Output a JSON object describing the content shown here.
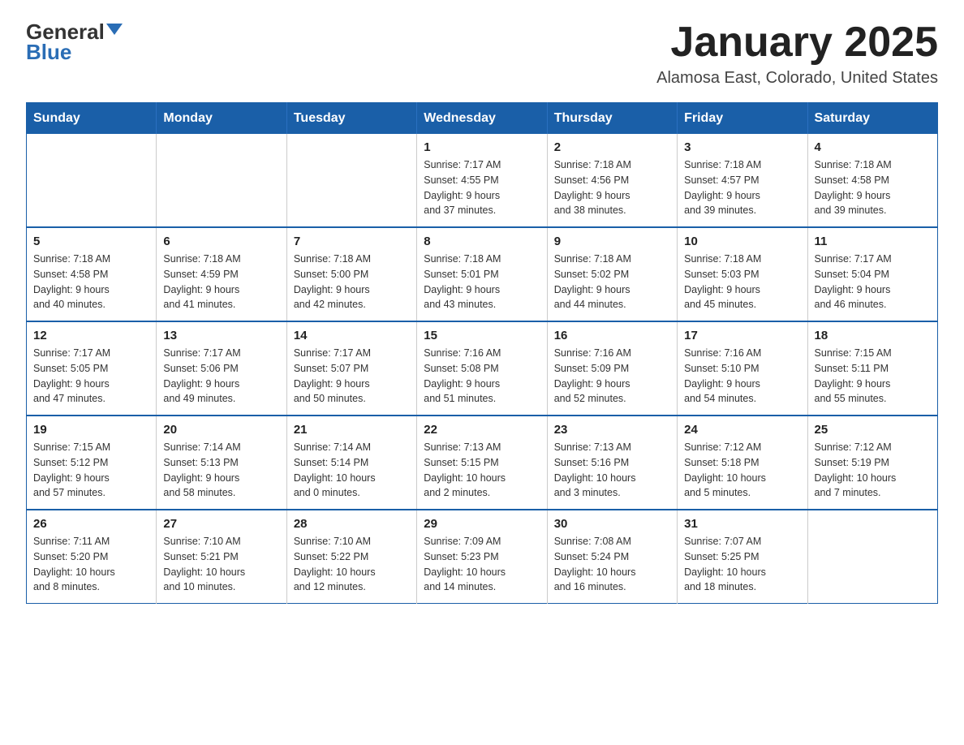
{
  "logo": {
    "general": "General",
    "blue": "Blue"
  },
  "title": "January 2025",
  "location": "Alamosa East, Colorado, United States",
  "days_of_week": [
    "Sunday",
    "Monday",
    "Tuesday",
    "Wednesday",
    "Thursday",
    "Friday",
    "Saturday"
  ],
  "weeks": [
    [
      {
        "day": "",
        "info": ""
      },
      {
        "day": "",
        "info": ""
      },
      {
        "day": "",
        "info": ""
      },
      {
        "day": "1",
        "info": "Sunrise: 7:17 AM\nSunset: 4:55 PM\nDaylight: 9 hours\nand 37 minutes."
      },
      {
        "day": "2",
        "info": "Sunrise: 7:18 AM\nSunset: 4:56 PM\nDaylight: 9 hours\nand 38 minutes."
      },
      {
        "day": "3",
        "info": "Sunrise: 7:18 AM\nSunset: 4:57 PM\nDaylight: 9 hours\nand 39 minutes."
      },
      {
        "day": "4",
        "info": "Sunrise: 7:18 AM\nSunset: 4:58 PM\nDaylight: 9 hours\nand 39 minutes."
      }
    ],
    [
      {
        "day": "5",
        "info": "Sunrise: 7:18 AM\nSunset: 4:58 PM\nDaylight: 9 hours\nand 40 minutes."
      },
      {
        "day": "6",
        "info": "Sunrise: 7:18 AM\nSunset: 4:59 PM\nDaylight: 9 hours\nand 41 minutes."
      },
      {
        "day": "7",
        "info": "Sunrise: 7:18 AM\nSunset: 5:00 PM\nDaylight: 9 hours\nand 42 minutes."
      },
      {
        "day": "8",
        "info": "Sunrise: 7:18 AM\nSunset: 5:01 PM\nDaylight: 9 hours\nand 43 minutes."
      },
      {
        "day": "9",
        "info": "Sunrise: 7:18 AM\nSunset: 5:02 PM\nDaylight: 9 hours\nand 44 minutes."
      },
      {
        "day": "10",
        "info": "Sunrise: 7:18 AM\nSunset: 5:03 PM\nDaylight: 9 hours\nand 45 minutes."
      },
      {
        "day": "11",
        "info": "Sunrise: 7:17 AM\nSunset: 5:04 PM\nDaylight: 9 hours\nand 46 minutes."
      }
    ],
    [
      {
        "day": "12",
        "info": "Sunrise: 7:17 AM\nSunset: 5:05 PM\nDaylight: 9 hours\nand 47 minutes."
      },
      {
        "day": "13",
        "info": "Sunrise: 7:17 AM\nSunset: 5:06 PM\nDaylight: 9 hours\nand 49 minutes."
      },
      {
        "day": "14",
        "info": "Sunrise: 7:17 AM\nSunset: 5:07 PM\nDaylight: 9 hours\nand 50 minutes."
      },
      {
        "day": "15",
        "info": "Sunrise: 7:16 AM\nSunset: 5:08 PM\nDaylight: 9 hours\nand 51 minutes."
      },
      {
        "day": "16",
        "info": "Sunrise: 7:16 AM\nSunset: 5:09 PM\nDaylight: 9 hours\nand 52 minutes."
      },
      {
        "day": "17",
        "info": "Sunrise: 7:16 AM\nSunset: 5:10 PM\nDaylight: 9 hours\nand 54 minutes."
      },
      {
        "day": "18",
        "info": "Sunrise: 7:15 AM\nSunset: 5:11 PM\nDaylight: 9 hours\nand 55 minutes."
      }
    ],
    [
      {
        "day": "19",
        "info": "Sunrise: 7:15 AM\nSunset: 5:12 PM\nDaylight: 9 hours\nand 57 minutes."
      },
      {
        "day": "20",
        "info": "Sunrise: 7:14 AM\nSunset: 5:13 PM\nDaylight: 9 hours\nand 58 minutes."
      },
      {
        "day": "21",
        "info": "Sunrise: 7:14 AM\nSunset: 5:14 PM\nDaylight: 10 hours\nand 0 minutes."
      },
      {
        "day": "22",
        "info": "Sunrise: 7:13 AM\nSunset: 5:15 PM\nDaylight: 10 hours\nand 2 minutes."
      },
      {
        "day": "23",
        "info": "Sunrise: 7:13 AM\nSunset: 5:16 PM\nDaylight: 10 hours\nand 3 minutes."
      },
      {
        "day": "24",
        "info": "Sunrise: 7:12 AM\nSunset: 5:18 PM\nDaylight: 10 hours\nand 5 minutes."
      },
      {
        "day": "25",
        "info": "Sunrise: 7:12 AM\nSunset: 5:19 PM\nDaylight: 10 hours\nand 7 minutes."
      }
    ],
    [
      {
        "day": "26",
        "info": "Sunrise: 7:11 AM\nSunset: 5:20 PM\nDaylight: 10 hours\nand 8 minutes."
      },
      {
        "day": "27",
        "info": "Sunrise: 7:10 AM\nSunset: 5:21 PM\nDaylight: 10 hours\nand 10 minutes."
      },
      {
        "day": "28",
        "info": "Sunrise: 7:10 AM\nSunset: 5:22 PM\nDaylight: 10 hours\nand 12 minutes."
      },
      {
        "day": "29",
        "info": "Sunrise: 7:09 AM\nSunset: 5:23 PM\nDaylight: 10 hours\nand 14 minutes."
      },
      {
        "day": "30",
        "info": "Sunrise: 7:08 AM\nSunset: 5:24 PM\nDaylight: 10 hours\nand 16 minutes."
      },
      {
        "day": "31",
        "info": "Sunrise: 7:07 AM\nSunset: 5:25 PM\nDaylight: 10 hours\nand 18 minutes."
      },
      {
        "day": "",
        "info": ""
      }
    ]
  ]
}
